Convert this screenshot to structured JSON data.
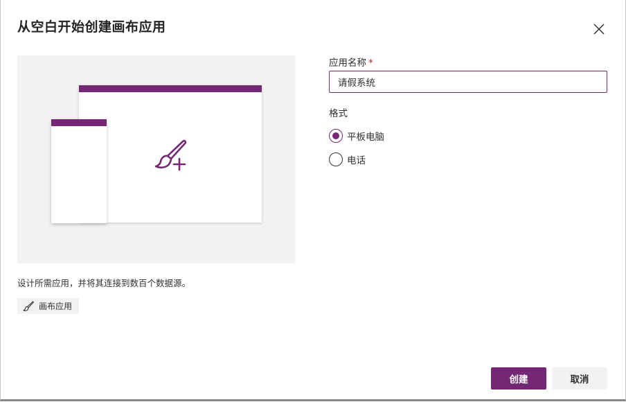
{
  "dialog": {
    "title": "从空白开始创建画布应用",
    "close_icon": "close-icon"
  },
  "preview": {
    "accent_color": "#742774",
    "background_color": "#f3f2f1",
    "icon": "paintbrush-add-icon"
  },
  "description": "设计所需应用，并将其连接到数百个数据源。",
  "tag": {
    "icon": "paintbrush-icon",
    "label": "画布应用"
  },
  "form": {
    "app_name_label": "应用名称",
    "required_marker": "*",
    "app_name_value": "请假系统",
    "format_label": "格式",
    "format_options": [
      {
        "label": "平板电脑",
        "selected": true
      },
      {
        "label": "电话",
        "selected": false
      }
    ]
  },
  "buttons": {
    "create": "创建",
    "cancel": "取消"
  },
  "colors": {
    "accent": "#742774",
    "required": "#a4262c"
  }
}
